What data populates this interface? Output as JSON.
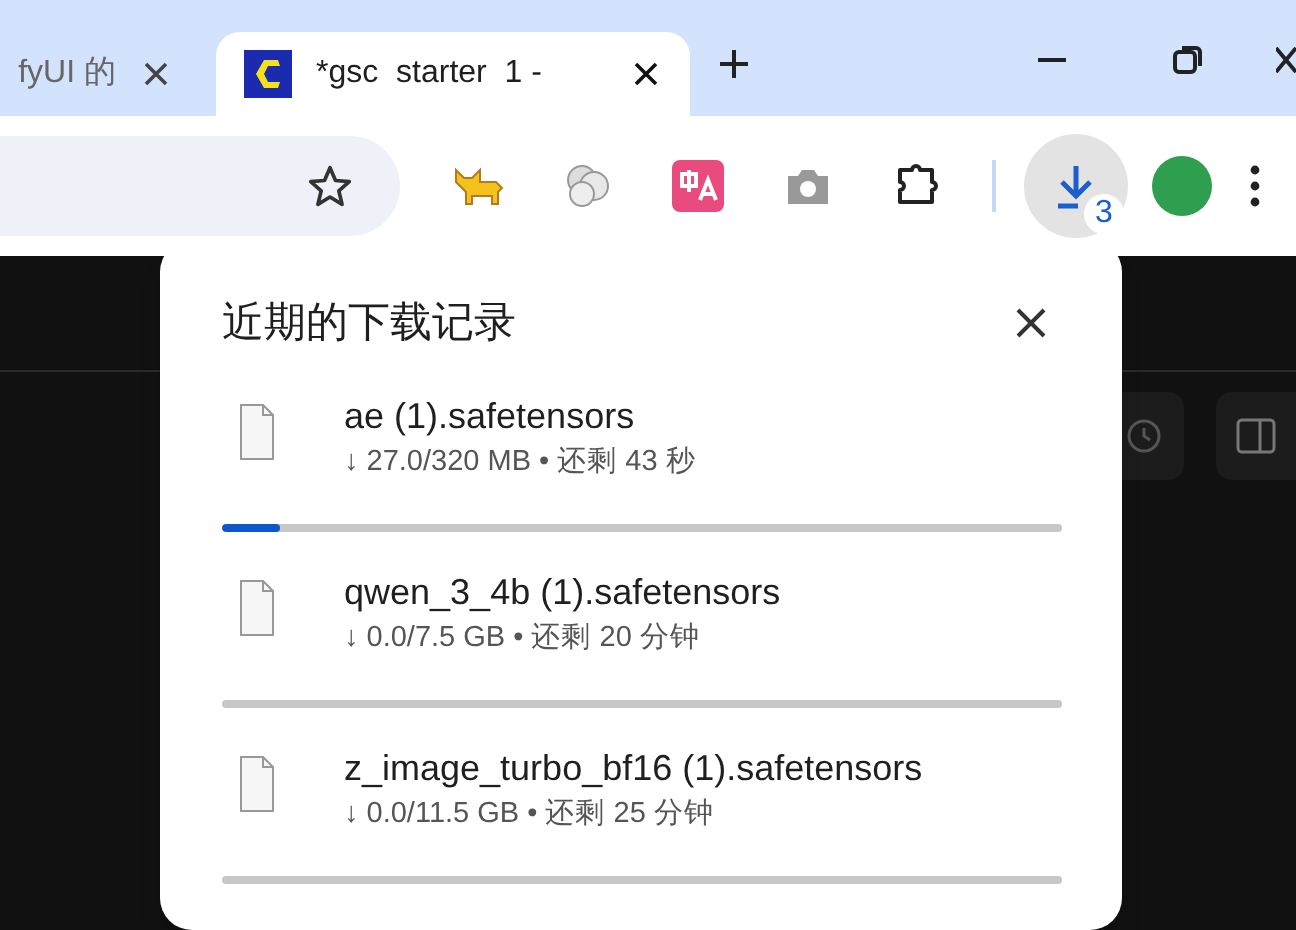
{
  "tabs": [
    {
      "title": "fyUI 的",
      "selected": false
    },
    {
      "title": "*gsc  starter  1 -",
      "selected": true
    }
  ],
  "toolbar": {
    "download_badge": "3"
  },
  "downloads_panel": {
    "title": "近期的下载记录",
    "items": [
      {
        "name": "ae (1).safetensors",
        "detail": "↓ 27.0/320 MB • 还剩 43 秒",
        "level": 0.07
      },
      {
        "name": "qwen_3_4b (1).safetensors",
        "detail": "↓ 0.0/7.5 GB • 还剩 20 分钟",
        "level": 0
      },
      {
        "name": "z_image_turbo_bf16 (1).safetensors",
        "detail": "↓ 0.0/11.5 GB • 还剩 25 分钟",
        "level": 0
      }
    ]
  }
}
